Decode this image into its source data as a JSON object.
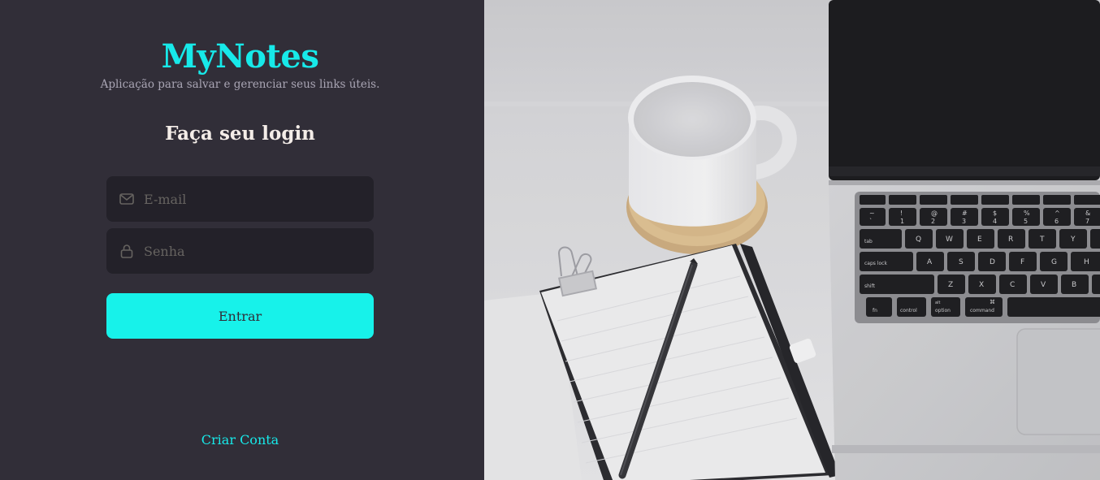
{
  "brand": {
    "name": "MyNotes",
    "tagline": "Aplicação para salvar e gerenciar seus links úteis."
  },
  "login": {
    "title": "Faça seu login",
    "email": {
      "placeholder": "E-mail",
      "value": ""
    },
    "password": {
      "placeholder": "Senha",
      "value": ""
    },
    "submit_label": "Entrar",
    "create_account_label": "Criar Conta"
  },
  "icons": {
    "email": "mail-icon",
    "password": "lock-icon"
  },
  "colors": {
    "accent": "#17e9e9",
    "button": "#17f2ea",
    "panel_bg": "#312e38",
    "input_bg": "#232129"
  },
  "hero": {
    "keyboard_keys": {
      "row1": [
        "~",
        "!",
        "@",
        "#",
        "$",
        "%",
        "^",
        "&"
      ],
      "row1_sub": [
        "`",
        "1",
        "2",
        "3",
        "4",
        "5",
        "6",
        "7"
      ],
      "row2": [
        "tab",
        "Q",
        "W",
        "E",
        "R",
        "T",
        "Y"
      ],
      "row3": [
        "caps lock",
        "A",
        "S",
        "D",
        "F",
        "G",
        "H"
      ],
      "row4": [
        "shift",
        "Z",
        "X",
        "C",
        "V",
        "B"
      ],
      "row5": [
        "fn",
        "control",
        "option",
        "command"
      ],
      "option_alt": "alt",
      "command_symbol": "⌘"
    }
  }
}
